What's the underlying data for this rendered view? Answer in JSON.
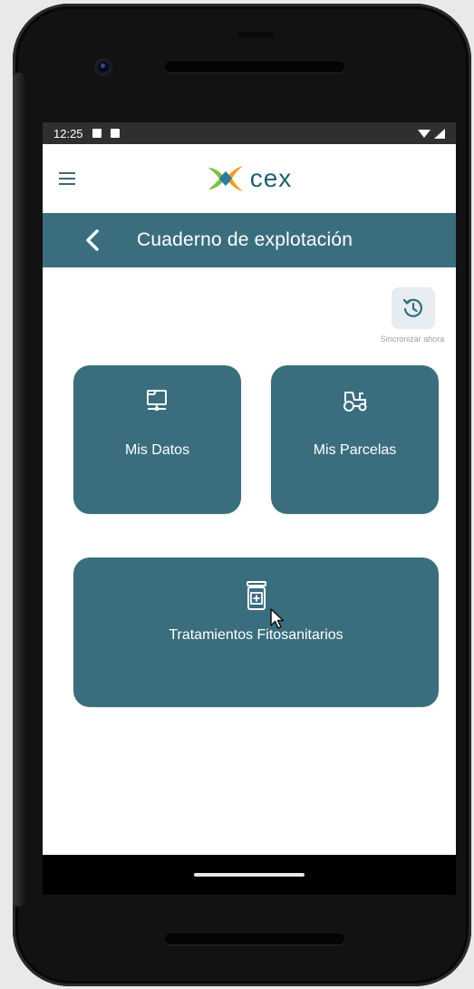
{
  "status_bar": {
    "time": "12:25"
  },
  "header": {
    "logo_text": "CEX",
    "menu_icon": "hamburger-menu-icon"
  },
  "title_bar": {
    "title": "Cuaderno de explotación",
    "back_icon": "chevron-left-icon"
  },
  "sync": {
    "icon": "history-icon",
    "label": "Sincronizar ahora"
  },
  "tiles": {
    "mis_datos": {
      "label": "Mis Datos",
      "icon": "folder-network-icon"
    },
    "mis_parcelas": {
      "label": "Mis Parcelas",
      "icon": "tractor-icon"
    },
    "tratamientos": {
      "label": "Tratamientos Fitosanitarios",
      "icon": "medicine-jar-icon"
    }
  },
  "colors": {
    "primary": "#3a6e7e",
    "status_bar": "#2f2f2f",
    "logo_blue": "#1f5f73",
    "logo_green": "#7cc242",
    "logo_orange": "#f29a1d"
  }
}
